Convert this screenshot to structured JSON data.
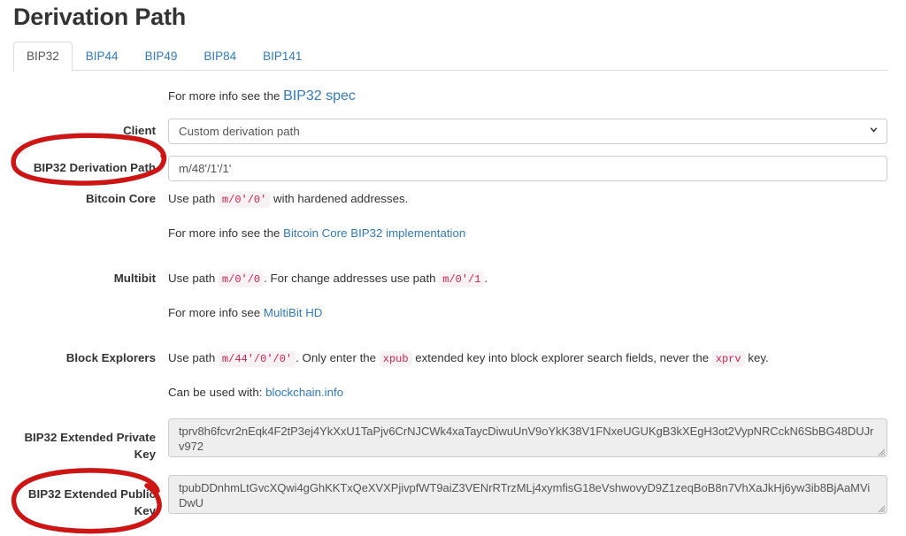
{
  "page": {
    "title": "Derivation Path"
  },
  "tabs": [
    {
      "label": "BIP32",
      "active": true
    },
    {
      "label": "BIP44",
      "active": false
    },
    {
      "label": "BIP49",
      "active": false
    },
    {
      "label": "BIP84",
      "active": false
    },
    {
      "label": "BIP141",
      "active": false
    }
  ],
  "intro": {
    "prefix": "For more info see the ",
    "link": "BIP32 spec"
  },
  "rows": {
    "client": {
      "label": "Client",
      "selected": "Custom derivation path"
    },
    "derivation_path": {
      "label": "BIP32 Derivation Path",
      "value": "m/48'/1'/1'"
    },
    "bitcoin_core": {
      "label": "Bitcoin Core",
      "line1_prefix": "Use path ",
      "line1_code": "m/0'/0'",
      "line1_suffix": " with hardened addresses.",
      "line2_prefix": "For more info see the ",
      "line2_link": "Bitcoin Core BIP32 implementation"
    },
    "multibit": {
      "label": "Multibit",
      "line1_prefix": "Use path ",
      "line1_code": "m/0'/0",
      "line1_mid": ". For change addresses use path ",
      "line1_code2": "m/0'/1",
      "line1_suffix": ".",
      "line2_prefix": "For more info see ",
      "line2_link": "MultiBit HD"
    },
    "block_explorers": {
      "label": "Block Explorers",
      "line1_prefix": "Use path ",
      "line1_code": "m/44'/0'/0'",
      "line1_mid": ". Only enter the ",
      "line1_code2": "xpub",
      "line1_mid2": " extended key into block explorer search fields, never the ",
      "line1_code3": "xprv",
      "line1_suffix": " key.",
      "line2_prefix": "Can be used with: ",
      "line2_link": "blockchain.info"
    },
    "ext_private_key": {
      "label": "BIP32 Extended Private Key",
      "value": "tprv8h6fcvr2nEqk4F2tP3ej4YkXxU1TaPjv6CrNJCWk4xaTaycDiwuUnV9oYkK38V1FNxeUGUKgB3kXEgH3ot2VypNRCckN6SbBG48DUJrv972"
    },
    "ext_public_key": {
      "label": "BIP32 Extended Public Key",
      "value": "tpubDDnhmLtGvcXQwi4gGhKKTxQeXVXPjivpfWT9aiZ3VENrRTrzMLj4xymfisG18eVshwovyD9Z1zeqBoB8n7VhXaJkHj6yw3ib8BjAaMViDwU"
    }
  },
  "annotations": {
    "color": "#cc1515",
    "items": [
      {
        "name": "ellipse-around-bip32-derivation-path-label"
      },
      {
        "name": "ellipse-around-bip32-extended-public-key-label"
      }
    ]
  },
  "icons": {
    "select_chevron": "chevron-down-icon",
    "resize_grip": "resize-grip-icon"
  }
}
